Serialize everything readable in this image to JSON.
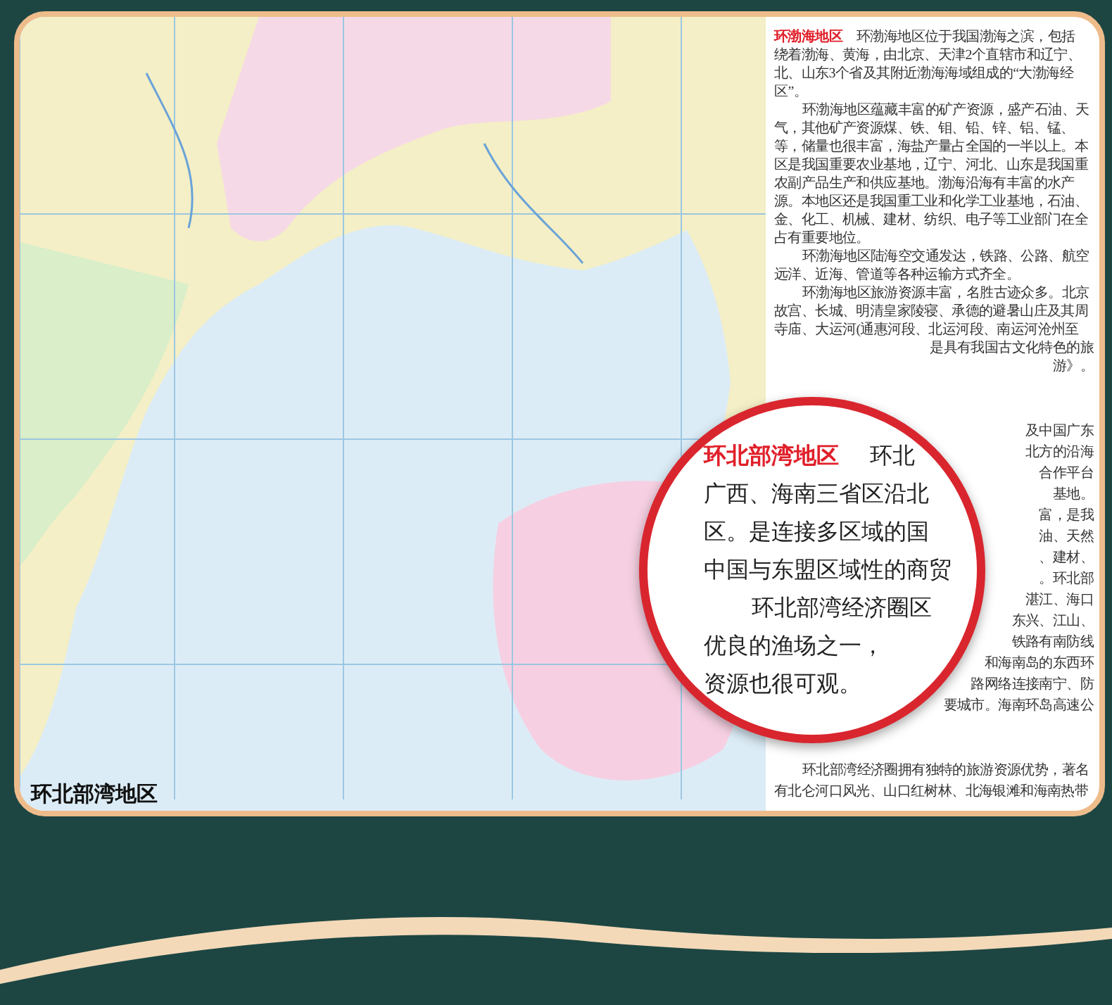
{
  "map": {
    "label": "环北部湾地区"
  },
  "article": {
    "blocks": [
      {
        "lines": [
          {
            "kind": "heading",
            "title": "环渤海地区",
            "text": "环渤海地区位于我国渤海之滨，包括"
          },
          {
            "kind": "line",
            "text": "绕着渤海、黄海，由北京、天津2个直辖市和辽宁、"
          },
          {
            "kind": "line",
            "text": "北、山东3个省及其附近渤海海域组成的“大渤海经"
          },
          {
            "kind": "line",
            "text": "区”。"
          },
          {
            "kind": "indent",
            "text": "环渤海地区蕴藏丰富的矿产资源，盛产石油、天"
          },
          {
            "kind": "line",
            "text": "气，其他矿产资源煤、铁、钼、铅、锌、铝、锰、"
          },
          {
            "kind": "line",
            "text": "等，储量也很丰富，海盐产量占全国的一半以上。本"
          },
          {
            "kind": "line",
            "text": "区是我国重要农业基地，辽宁、河北、山东是我国重"
          },
          {
            "kind": "line",
            "text": "农副产品生产和供应基地。渤海沿海有丰富的水产"
          },
          {
            "kind": "line",
            "text": "源。本地区还是我国重工业和化学工业基地，石油、"
          },
          {
            "kind": "line",
            "text": "金、化工、机械、建材、纺织、电子等工业部门在全"
          },
          {
            "kind": "line",
            "text": "占有重要地位。"
          },
          {
            "kind": "indent",
            "text": "环渤海地区陆海空交通发达，铁路、公路、航空"
          },
          {
            "kind": "line",
            "text": "远洋、近海、管道等各种运输方式齐全。"
          },
          {
            "kind": "indent",
            "text": "环渤海地区旅游资源丰富，名胜古迹众多。北京"
          },
          {
            "kind": "line",
            "text": "故宫、长城、明清皇家陵寝、承德的避暑山庄及其周"
          },
          {
            "kind": "line",
            "text": "寺庙、大运河(通惠河段、北运河段、南运河沧州至"
          },
          {
            "kind": "fragment",
            "text": "是具有我国古文化特色的旅"
          },
          {
            "kind": "fragment",
            "text": "游》。"
          }
        ]
      },
      {
        "lines": [
          {
            "kind": "fragment",
            "text": "及中国广东"
          },
          {
            "kind": "fragment",
            "text": "北方的沿海"
          },
          {
            "kind": "fragment",
            "text": "合作平台"
          },
          {
            "kind": "fragment",
            "text": "基地。"
          },
          {
            "kind": "fragment",
            "text": "富，是我"
          },
          {
            "kind": "fragment",
            "text": "油、天然"
          },
          {
            "kind": "fragment",
            "text": "、建材、"
          },
          {
            "kind": "fragment",
            "text": "。环北部"
          },
          {
            "kind": "fragment",
            "text": "湛江、海口"
          },
          {
            "kind": "fragment",
            "text": "东兴、江山、"
          },
          {
            "kind": "fragment",
            "text": "铁路有南防线"
          },
          {
            "kind": "fragment",
            "text": "和海南岛的东西环"
          },
          {
            "kind": "fragment",
            "text": "路网络连接南宁、防"
          },
          {
            "kind": "fragment",
            "text": "要城市。海南环岛高速公"
          }
        ]
      },
      {
        "lines": [
          {
            "kind": "indent",
            "text": "环北部湾经济圈拥有独特的旅游资源优势，著名"
          },
          {
            "kind": "line",
            "text": "有北仑河口风光、山口红树林、北海银滩和海南热带"
          }
        ]
      }
    ]
  },
  "magnifier": {
    "lines": [
      {
        "kind": "heading",
        "title": "环北部湾地区",
        "text": "环北"
      },
      {
        "kind": "line",
        "text": "广西、海南三省区沿北"
      },
      {
        "kind": "line",
        "text": "区。是连接多区域的国"
      },
      {
        "kind": "line",
        "text": "中国与东盟区域性的商贸"
      },
      {
        "kind": "indent",
        "text": "环北部湾经济圈区"
      },
      {
        "kind": "line",
        "text": "优良的渔场之一，"
      },
      {
        "kind": "line",
        "text": "资源也很可观。"
      }
    ]
  }
}
